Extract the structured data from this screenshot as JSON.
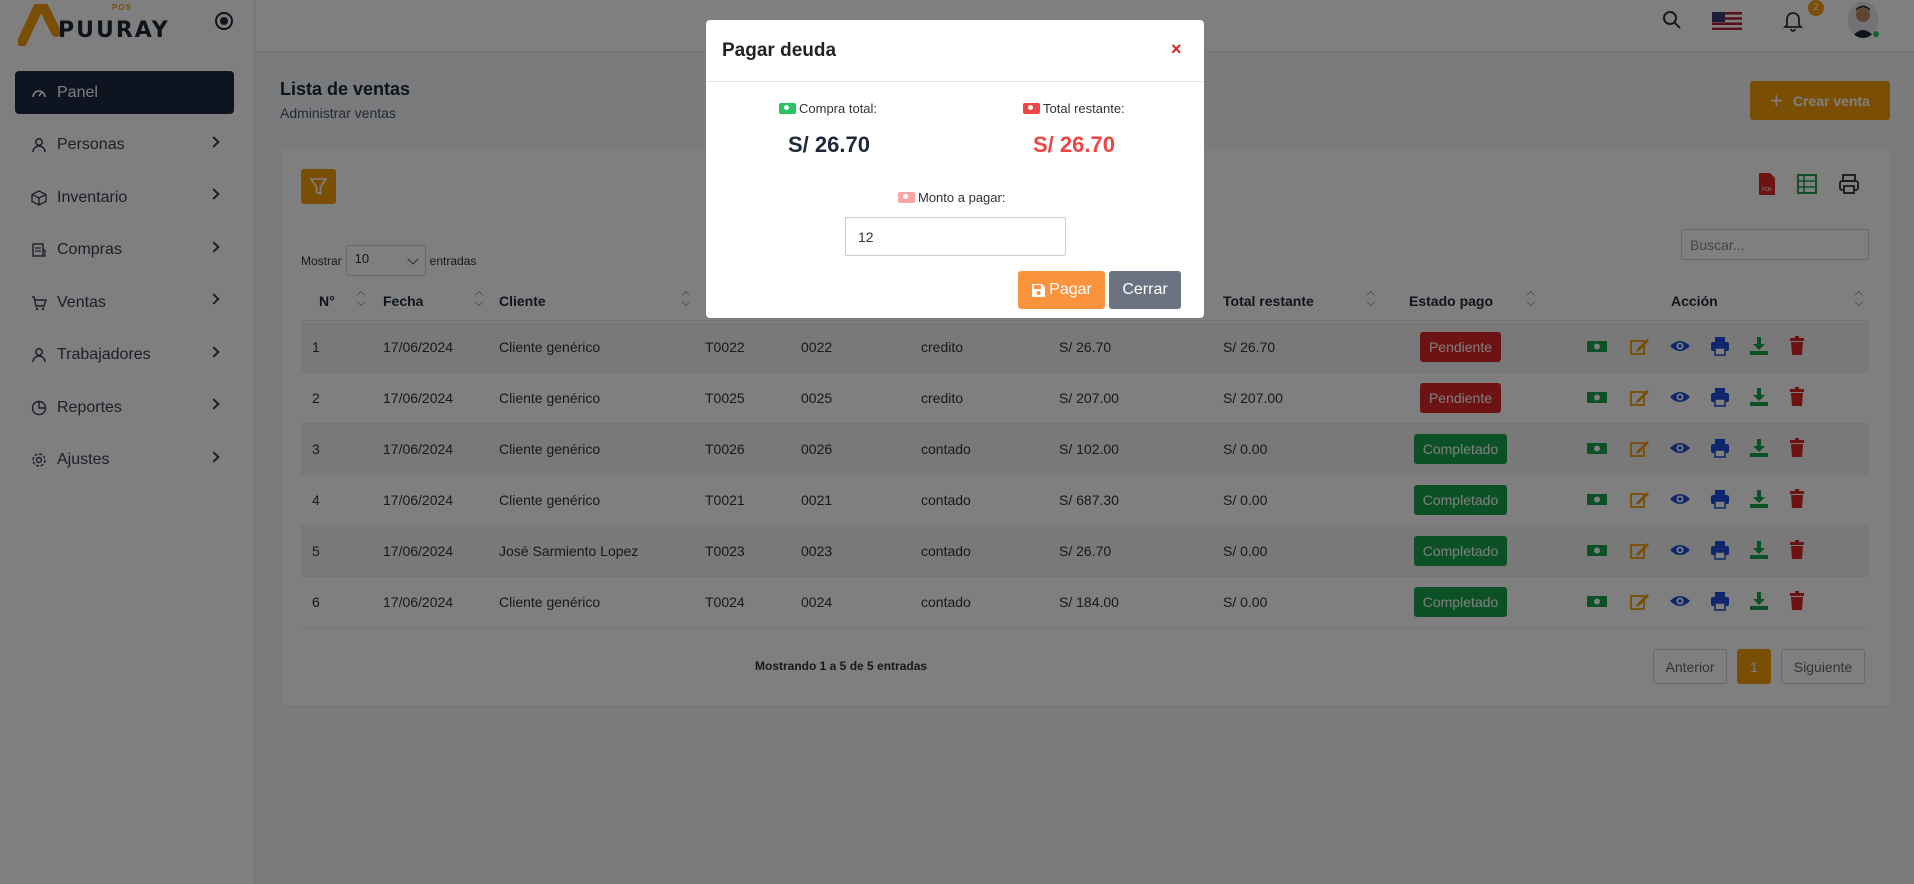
{
  "brand": {
    "name": "PUURAY",
    "sub": "POS"
  },
  "topbar": {
    "notification_count": "2"
  },
  "sidebar": {
    "items": [
      {
        "label": "Panel",
        "icon": "dashboard-icon",
        "active": true
      },
      {
        "label": "Personas",
        "icon": "user-icon"
      },
      {
        "label": "Inventario",
        "icon": "box-icon"
      },
      {
        "label": "Compras",
        "icon": "receipt-icon"
      },
      {
        "label": "Ventas",
        "icon": "cart-icon"
      },
      {
        "label": "Trabajadores",
        "icon": "user-icon"
      },
      {
        "label": "Reportes",
        "icon": "pie-chart-icon"
      },
      {
        "label": "Ajustes",
        "icon": "gear-icon"
      }
    ]
  },
  "page": {
    "title": "Lista de ventas",
    "subtitle": "Administrar ventas",
    "create_label": "Crear venta"
  },
  "table": {
    "length_label_pre": "Mostrar",
    "length_value": "10",
    "length_label_post": "entradas",
    "search_placeholder": "Buscar...",
    "headers": [
      "N°",
      "Fecha",
      "Cliente",
      "Total restante",
      "Estado pago",
      "Acción"
    ],
    "rows": [
      {
        "n": "1",
        "fecha": "17/06/2024",
        "cliente": "Cliente genérico",
        "ticket": "T0022",
        "num": "0022",
        "tipo": "credito",
        "total": "S/ 26.70",
        "restante": "S/ 26.70",
        "estado": "Pendiente"
      },
      {
        "n": "2",
        "fecha": "17/06/2024",
        "cliente": "Cliente genérico",
        "ticket": "T0025",
        "num": "0025",
        "tipo": "credito",
        "total": "S/ 207.00",
        "restante": "S/ 207.00",
        "estado": "Pendiente"
      },
      {
        "n": "3",
        "fecha": "17/06/2024",
        "cliente": "Cliente genérico",
        "ticket": "T0026",
        "num": "0026",
        "tipo": "contado",
        "total": "S/ 102.00",
        "restante": "S/ 0.00",
        "estado": "Completado"
      },
      {
        "n": "4",
        "fecha": "17/06/2024",
        "cliente": "Cliente genérico",
        "ticket": "T0021",
        "num": "0021",
        "tipo": "contado",
        "total": "S/ 687.30",
        "restante": "S/ 0.00",
        "estado": "Completado"
      },
      {
        "n": "5",
        "fecha": "17/06/2024",
        "cliente": "José Sarmiento Lopez",
        "ticket": "T0023",
        "num": "0023",
        "tipo": "contado",
        "total": "S/ 26.70",
        "restante": "S/ 0.00",
        "estado": "Completado"
      },
      {
        "n": "6",
        "fecha": "17/06/2024",
        "cliente": "Cliente genérico",
        "ticket": "T0024",
        "num": "0024",
        "tipo": "contado",
        "total": "S/ 184.00",
        "restante": "S/ 0.00",
        "estado": "Completado"
      }
    ],
    "info": "Mostrando 1 a 5 de 5 entradas",
    "pagination": {
      "prev": "Anterior",
      "current": "1",
      "next": "Siguiente"
    }
  },
  "modal": {
    "title": "Pagar deuda",
    "close": "×",
    "total_label": "Compra total:",
    "total_value": "S/ 26.70",
    "remaining_label": "Total restante:",
    "remaining_value": "S/ 26.70",
    "amount_label": "Monto a pagar:",
    "amount_value": "12",
    "pay_label": "Pagar",
    "close_label": "Cerrar"
  },
  "colors": {
    "accent": "#f59e0b",
    "navy": "#1e2842",
    "danger": "#dc2626",
    "success": "#16a34a",
    "pay": "#fb923c"
  }
}
